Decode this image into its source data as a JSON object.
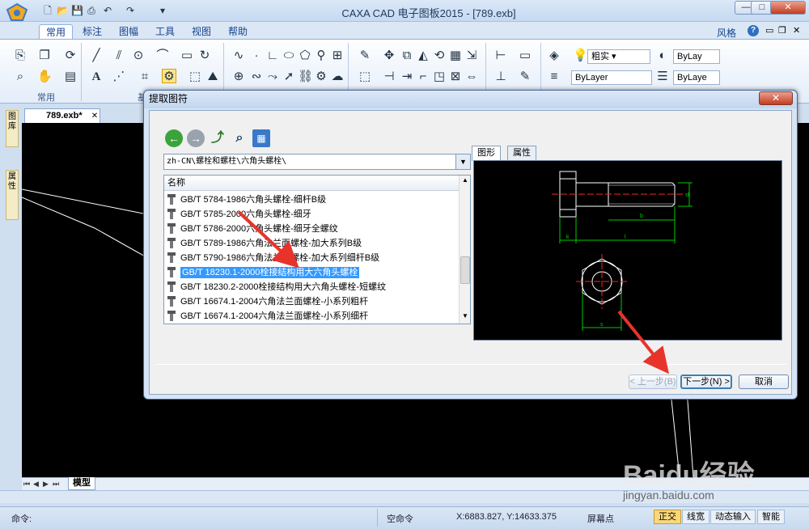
{
  "window": {
    "title": "CAXA CAD 电子图板2015 - [789.exb]",
    "controls": {
      "minimize": "—",
      "restore": "□",
      "close": "✕"
    }
  },
  "ribbon": {
    "tabs": [
      "常用",
      "标注",
      "图幅",
      "工具",
      "视图",
      "帮助"
    ],
    "active_tab": "常用",
    "right_items": {
      "style_label": "风格",
      "help": "?"
    },
    "group_labels": {
      "common": "常用",
      "second": "基"
    },
    "properties": {
      "linewidth_label": "粗实",
      "color_combo": "ByLay",
      "linetype_combo": "ByLayer",
      "lineweight_combo": "ByLaye"
    }
  },
  "left_dock": {
    "tab1": "图库",
    "tab2": "属性"
  },
  "document": {
    "tab_label": "789.exb*",
    "tab_close": "✕",
    "model_tab": "模型"
  },
  "dialog": {
    "title": "提取图符",
    "close": "✕",
    "path": "zh-CN\\螺栓和螺柱\\六角头螺栓\\",
    "list_header": "名称",
    "items": [
      "GB/T 5784-1986六角头螺栓-细杆B级",
      "GB/T 5785-2000六角头螺栓-细牙",
      "GB/T 5786-2000六角头螺栓-细牙全螺纹",
      "GB/T 5789-1986六角法兰面螺栓-加大系列B级",
      "GB/T 5790-1986六角法兰面螺栓-加大系列细杆B级",
      "GB/T 18230.1-2000栓接结构用大六角头螺栓",
      "GB/T 18230.2-2000栓接结构用大六角头螺栓-短螺纹",
      "GB/T 16674.1-2004六角法兰面螺栓-小系列粗杆",
      "GB/T 16674.1-2004六角法兰面螺栓-小系列细杆"
    ],
    "selected_index": 5,
    "preview_tabs": [
      "图形",
      "属性"
    ],
    "preview_dims": {
      "b": "b",
      "l": "l",
      "k": "k",
      "s": "s",
      "d": "d"
    },
    "buttons": {
      "prev": "< 上一步(B)",
      "next": "下一步(N) >",
      "cancel": "取消"
    }
  },
  "statusbar": {
    "command_label": "命令:",
    "empty_command": "空命令",
    "coords": "X:6883.827, Y:14633.375",
    "screen_point": "屏幕点",
    "toggles": [
      "正交",
      "线宽",
      "动态输入",
      "智能"
    ],
    "active_toggle": "正交"
  },
  "watermark": {
    "brand": "Baidu经验",
    "url": "jingyan.baidu.com"
  },
  "colors": {
    "accent": "#3399ff",
    "dim_green": "#00cc00",
    "center_red": "#ff2020",
    "arrow_red": "#e8332a"
  }
}
